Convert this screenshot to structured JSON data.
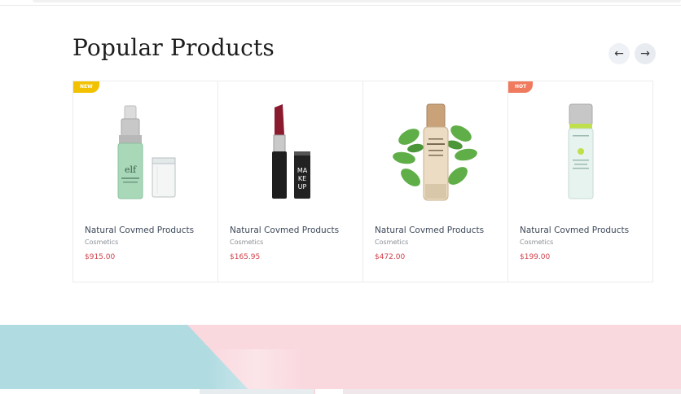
{
  "section": {
    "title": "Popular Products"
  },
  "nav": {
    "prev_icon": "arrow-left-icon",
    "next_icon": "arrow-right-icon",
    "prev_glyph": "←",
    "next_glyph": "→"
  },
  "products": [
    {
      "badge": "NEW",
      "badge_color": "#f2c200",
      "image": "elf-primer-bottle",
      "name": "Natural Covmed Products",
      "category": "Cosmetics",
      "price": "$915.00"
    },
    {
      "badge": "",
      "image": "lipstick",
      "name": "Natural Covmed Products",
      "category": "Cosmetics",
      "price": "$165.95"
    },
    {
      "badge": "",
      "image": "serum-bottle-with-leaves",
      "name": "Natural Covmed Products",
      "category": "Cosmetics",
      "price": "$472.00"
    },
    {
      "badge": "HOT",
      "badge_color": "#f07a5e",
      "image": "lotion-bottle",
      "name": "Natural Covmed Products",
      "category": "Cosmetics",
      "price": "$199.00"
    }
  ],
  "colors": {
    "price": "#d2404a",
    "banner_pink": "#f9d8de",
    "banner_blue": "#b0dbe1"
  }
}
